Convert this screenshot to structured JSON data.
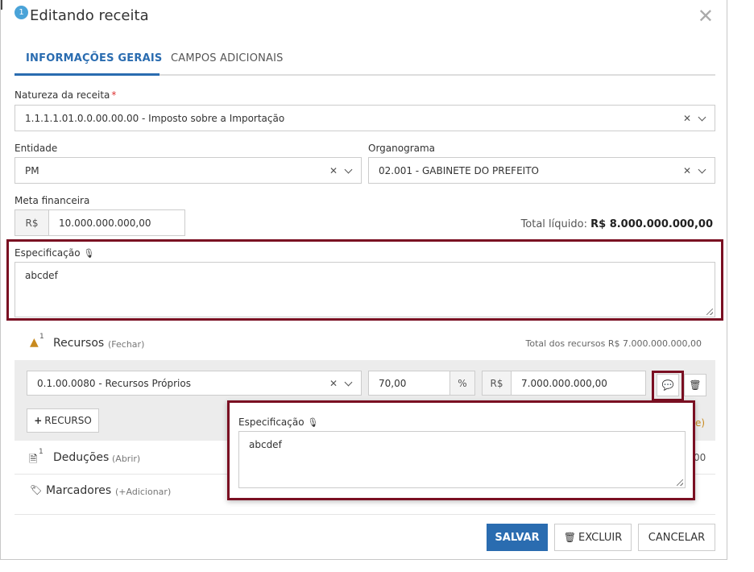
{
  "dialog": {
    "badge": "1",
    "title": "Editando receita"
  },
  "tabs": [
    {
      "label": "INFORMAÇÕES GERAIS",
      "active": true
    },
    {
      "label": "CAMPOS ADICIONAIS",
      "active": false
    }
  ],
  "natureza": {
    "label": "Natureza da receita",
    "required_mark": "*",
    "value": "1.1.1.1.01.0.0.00.00.00 - Imposto sobre a Importação"
  },
  "entidade": {
    "label": "Entidade",
    "value": "PM"
  },
  "organograma": {
    "label": "Organograma",
    "value": "02.001 - GABINETE DO PREFEITO"
  },
  "meta": {
    "label": "Meta financeira",
    "currency": "R$",
    "value": "10.000.000.000,00"
  },
  "total_liquido": {
    "label": "Total líquido:",
    "value": "R$ 8.000.000.000,00"
  },
  "especificacao": {
    "label": "Especificação",
    "value": "abcdef"
  },
  "recursos": {
    "badge": "1",
    "title": "Recursos",
    "toggle": "(Fechar)",
    "total": "Total dos recursos R$ 7.000.000.000,00",
    "item": {
      "recurso": "0.1.00.0080 - Recursos Próprios",
      "percent": "70,00",
      "percent_symbol": "%",
      "currency": "R$",
      "amount": "7.000.000.000,00"
    },
    "add_button": "RECURSO",
    "partial_right_text": "e)"
  },
  "deducoes": {
    "badge": "1",
    "title": "Deduções",
    "toggle": "(Abrir)",
    "partial_right_text": "00"
  },
  "marcadores": {
    "title": "Marcadores",
    "toggle": "(+Adicionar)"
  },
  "popover": {
    "label": "Especificação",
    "value": "abcdef"
  },
  "footer": {
    "save": "SALVAR",
    "delete": "EXCLUIR",
    "cancel": "CANCELAR"
  },
  "colors": {
    "primary": "#2a6cb0",
    "highlight": "#7a0f22",
    "warning": "#c88a1e"
  }
}
